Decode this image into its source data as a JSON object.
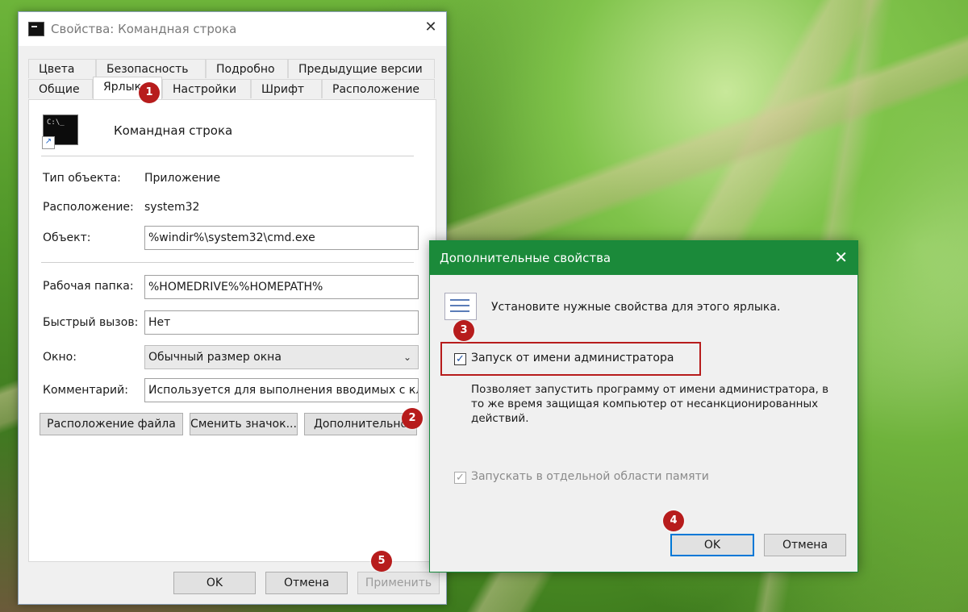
{
  "properties_window": {
    "title": "Свойства: Командная строка",
    "close_glyph": "✕",
    "tabs_row_back": [
      "Цвета",
      "Безопасность",
      "Подробно",
      "Предыдущие версии"
    ],
    "tabs_row_front": [
      "Общие",
      "Ярлык",
      "Настройки",
      "Шрифт",
      "Расположение"
    ],
    "active_tab": "Ярлык",
    "shortcut_name": "Командная строка",
    "icon_prompt": "C:\\_",
    "fields": {
      "object_type_label": "Тип объекта:",
      "object_type_value": "Приложение",
      "location_label": "Расположение:",
      "location_value": "system32",
      "target_label": "Объект:",
      "target_value": "%windir%\\system32\\cmd.exe",
      "start_in_label": "Рабочая папка:",
      "start_in_value": "%HOMEDRIVE%%HOMEPATH%",
      "hotkey_label": "Быстрый вызов:",
      "hotkey_value": "Нет",
      "run_label": "Окно:",
      "run_value": "Обычный размер окна",
      "comment_label": "Комментарий:",
      "comment_value": "Используется для выполнения вводимых с кла"
    },
    "buttons": {
      "open_location": "Расположение файла",
      "change_icon": "Сменить значок...",
      "advanced": "Дополнительно",
      "ok": "OK",
      "cancel": "Отмена",
      "apply": "Применить"
    }
  },
  "advanced_dialog": {
    "title": "Дополнительные свойства",
    "close_glyph": "✕",
    "intro": "Установите нужные свойства для этого ярлыка.",
    "run_as_admin_label": "Запуск от имени администратора",
    "run_as_admin_checked": true,
    "description_lines": [
      "Позволяет запустить программу от имени администратора, в",
      "то же время защищая компьютер от несанкционированных",
      "действий."
    ],
    "separate_memory_label": "Запускать в отдельной области памяти",
    "separate_memory_checked": true,
    "ok": "OK",
    "cancel": "Отмена",
    "check_glyph": "✓"
  },
  "annotations": {
    "badges": [
      "1",
      "2",
      "3",
      "4",
      "5"
    ],
    "badge_color": "#b71c1c"
  },
  "colors": {
    "dialog_titlebar": "#1b8a3a",
    "default_button_border": "#0078d7"
  }
}
